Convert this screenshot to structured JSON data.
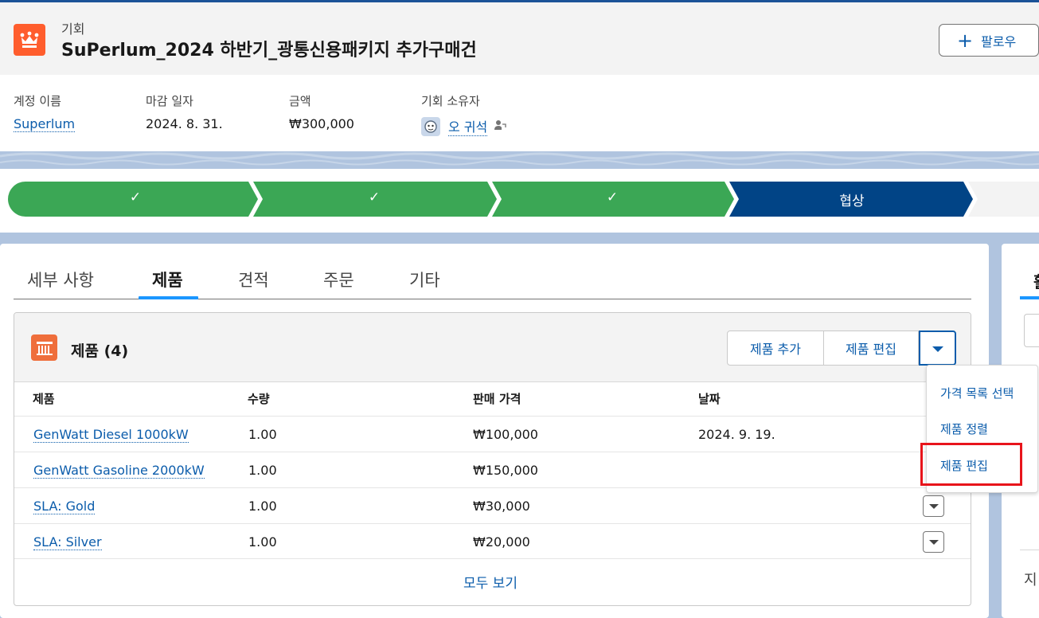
{
  "header": {
    "object_type": "기회",
    "title": "SuPerlum_2024 하반기_광통신용패키지 추가구매건",
    "follow_label": "팔로우",
    "icon": "crown-icon",
    "icon_color": "#ff5d2d"
  },
  "highlights": [
    {
      "label": "계정 이름",
      "value": "Superlum"
    },
    {
      "label": "마감 일자",
      "value": "2024. 8. 31."
    },
    {
      "label": "금액",
      "value": "₩300,000"
    },
    {
      "label": "기회 소유자",
      "value": "오 귀석"
    }
  ],
  "path": {
    "stages": [
      {
        "label": "✓",
        "state": "complete"
      },
      {
        "label": "✓",
        "state": "complete"
      },
      {
        "label": "✓",
        "state": "complete"
      },
      {
        "label": "협상",
        "state": "current"
      },
      {
        "label": "",
        "state": "incomplete"
      }
    ],
    "colors": {
      "complete": "#3ba755",
      "current": "#014486",
      "incomplete": "#f3f3f3"
    }
  },
  "tabs": [
    {
      "label": "세부 사항",
      "active": false
    },
    {
      "label": "제품",
      "active": true
    },
    {
      "label": "견적",
      "active": false
    },
    {
      "label": "주문",
      "active": false
    },
    {
      "label": "기타",
      "active": false
    }
  ],
  "related_list": {
    "title": "제품 (4)",
    "icon": "product-icon",
    "buttons": {
      "add": "제품 추가",
      "edit": "제품 편집"
    },
    "columns": [
      "제품",
      "수량",
      "판매 가격",
      "날짜"
    ],
    "rows": [
      {
        "product": "GenWatt Diesel 1000kW",
        "quantity": "1.00",
        "price": "₩100,000",
        "date": "2024. 9. 19."
      },
      {
        "product": "GenWatt Gasoline 2000kW",
        "quantity": "1.00",
        "price": "₩150,000",
        "date": ""
      },
      {
        "product": "SLA: Gold",
        "quantity": "1.00",
        "price": "₩30,000",
        "date": ""
      },
      {
        "product": "SLA: Silver",
        "quantity": "1.00",
        "price": "₩20,000",
        "date": ""
      }
    ],
    "view_all": "모두 보기"
  },
  "dropdown_menu": {
    "items": [
      "가격 목록 선택",
      "제품 정렬",
      "제품 편집"
    ],
    "highlighted": "제품 편집",
    "highlight_color": "#e8141b"
  },
  "right_panel": {
    "tab_fragment": "활",
    "text_fragment": "지"
  }
}
